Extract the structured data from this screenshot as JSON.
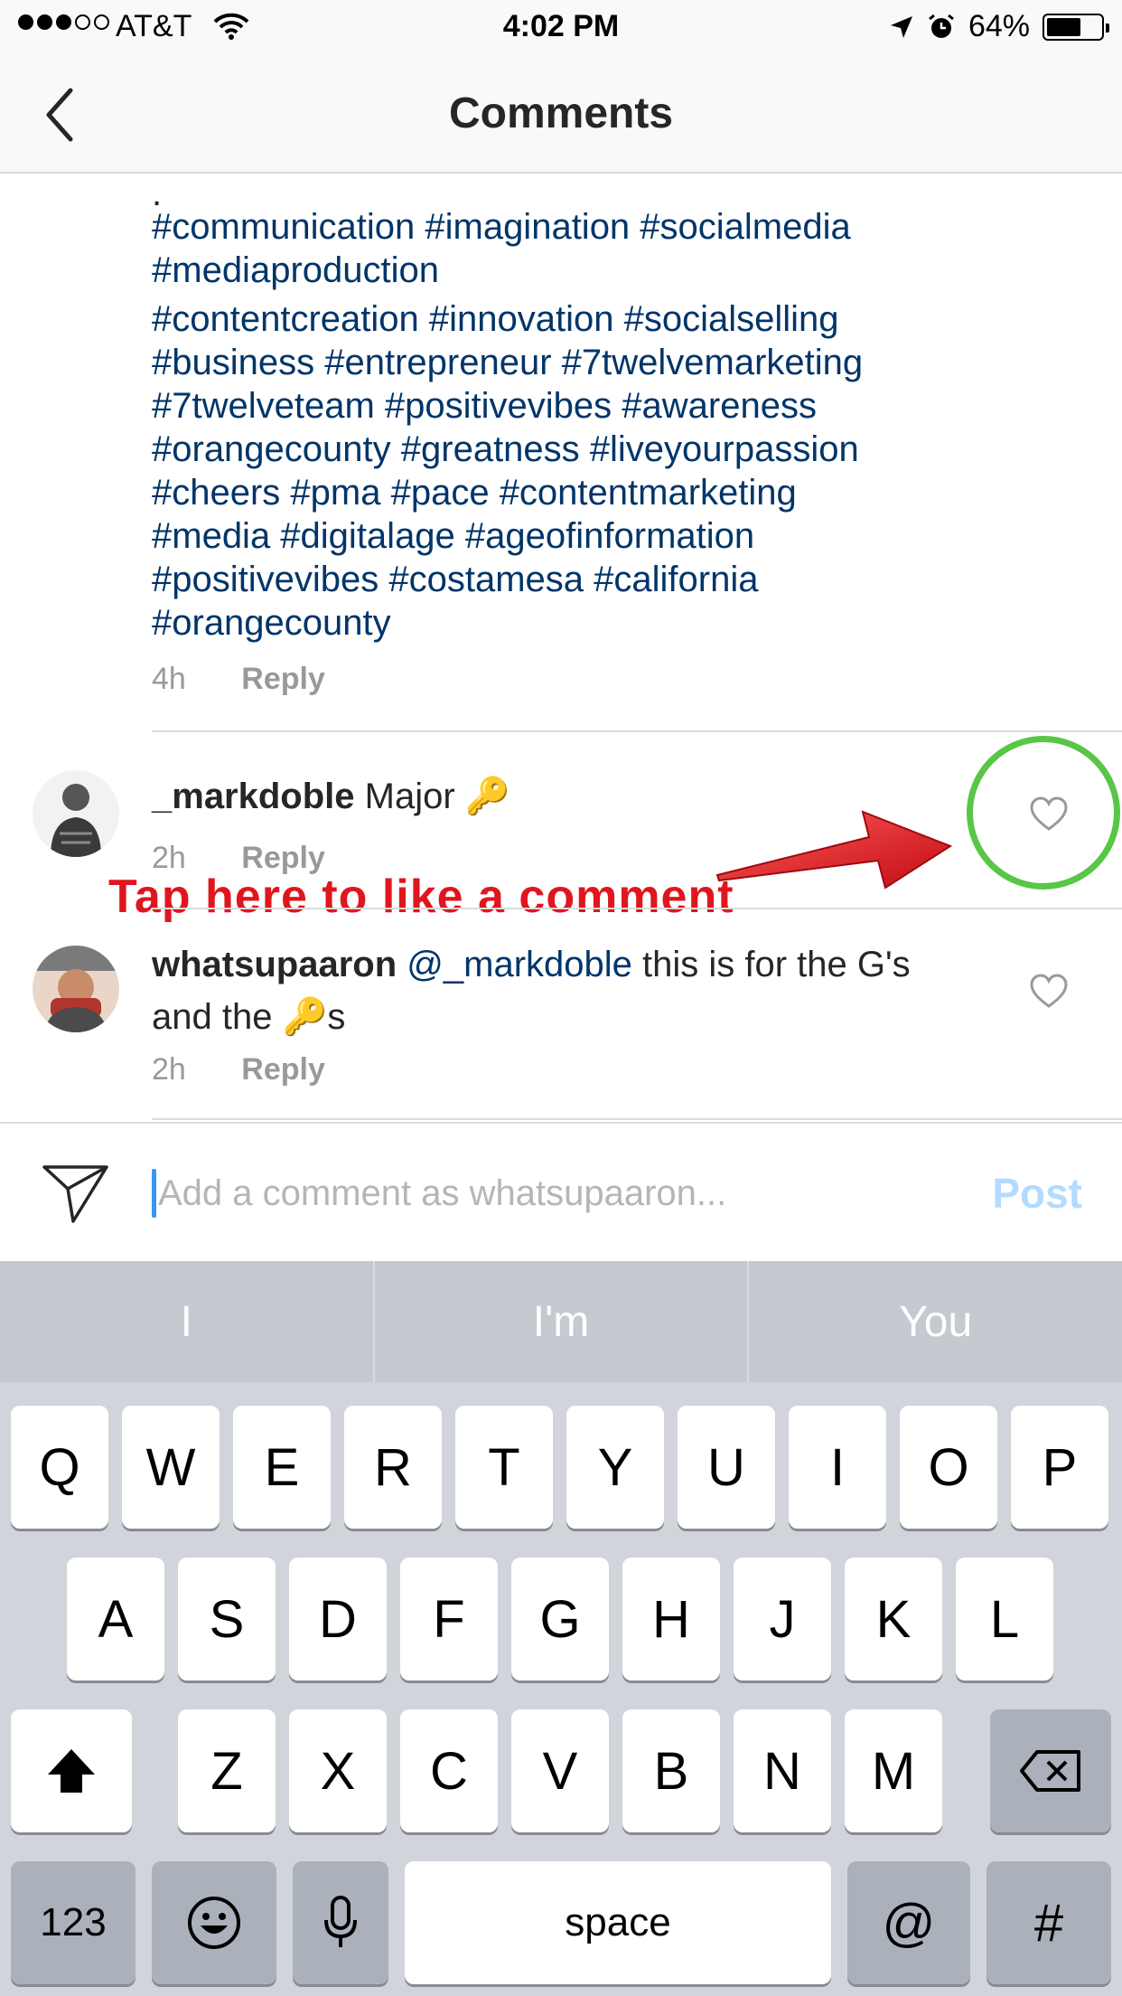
{
  "status_bar": {
    "carrier": "AT&T",
    "time": "4:02 PM",
    "battery_percent": "64%",
    "battery_level": 0.64,
    "signal_bars": 3,
    "signal_max": 5,
    "icons": [
      "wifi-icon",
      "location-arrow-icon",
      "alarm-clock-icon",
      "battery-icon"
    ]
  },
  "nav": {
    "title": "Comments",
    "back_icon": "chevron-left-icon"
  },
  "caption": {
    "dot": ".",
    "lines": [
      "#communication #imagination #socialmedia",
      "#mediaproduction",
      "#contentcreation #innovation #socialselling",
      "#business #entrepreneur #7twelvemarketing",
      "#7twelveteam #positivevibes #awareness",
      "#orangecounty #greatness #liveyourpassion",
      "#cheers #pma #pace #contentmarketing",
      "#media #digitalage #ageofinformation",
      "#positivevibes #costamesa #california",
      "#orangecounty"
    ],
    "time": "4h",
    "reply": "Reply"
  },
  "comments": [
    {
      "username": "_markdoble",
      "text": "Major 🔑",
      "time": "2h",
      "reply": "Reply"
    },
    {
      "username": "whatsupaaron",
      "mention": "@_markdoble",
      "text_1": " this is for the G's",
      "text_2": "and the 🔑s",
      "time": "2h",
      "reply": "Reply"
    }
  ],
  "annotation": {
    "text": "Tap here to like a comment"
  },
  "input": {
    "placeholder": "Add a comment as whatsupaaron...",
    "post_label": "Post"
  },
  "keyboard": {
    "suggestions": [
      "I",
      "I'm",
      "You"
    ],
    "row1": [
      "Q",
      "W",
      "E",
      "R",
      "T",
      "Y",
      "U",
      "I",
      "O",
      "P"
    ],
    "row2": [
      "A",
      "S",
      "D",
      "F",
      "G",
      "H",
      "J",
      "K",
      "L"
    ],
    "row3": [
      "Z",
      "X",
      "C",
      "V",
      "B",
      "N",
      "M"
    ],
    "numbers_label": "123",
    "space_label": "space",
    "at_label": "@",
    "hash_label": "#"
  },
  "colors": {
    "hashtag": "#003569",
    "annotation": "#e0161e",
    "ring": "#58c646",
    "post": "#b3dbff",
    "cursor": "#3897f0"
  }
}
